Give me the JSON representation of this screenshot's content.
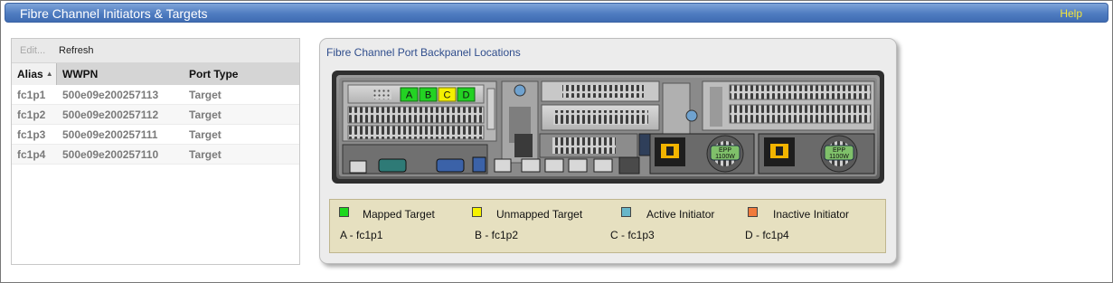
{
  "window": {
    "title": "Fibre Channel Initiators & Targets",
    "help_label": "Help"
  },
  "toolbar": {
    "edit_label": "Edit...",
    "refresh_label": "Refresh"
  },
  "table": {
    "columns": [
      "Alias",
      "WWPN",
      "Port Type"
    ],
    "sort_indicator": "▲",
    "rows": [
      {
        "alias": "fc1p1",
        "wwpn": "500e09e200257113",
        "port_type": "Target"
      },
      {
        "alias": "fc1p2",
        "wwpn": "500e09e200257112",
        "port_type": "Target"
      },
      {
        "alias": "fc1p3",
        "wwpn": "500e09e200257111",
        "port_type": "Target"
      },
      {
        "alias": "fc1p4",
        "wwpn": "500e09e200257110",
        "port_type": "Target"
      }
    ]
  },
  "backpanel": {
    "title": "Fibre Channel Port Backpanel Locations",
    "ports": [
      {
        "letter": "A",
        "color": "#23d223"
      },
      {
        "letter": "B",
        "color": "#23d223"
      },
      {
        "letter": "C",
        "color": "#f4f000"
      },
      {
        "letter": "D",
        "color": "#23d223"
      }
    ],
    "psu_label": "1100W",
    "psu_brand": "EPP"
  },
  "legend": {
    "items": [
      {
        "label": "Mapped Target",
        "color": "#1ed81e"
      },
      {
        "label": "Unmapped Target",
        "color": "#f6f200"
      },
      {
        "label": "Active Initiator",
        "color": "#68b6c9"
      },
      {
        "label": "Inactive Initiator",
        "color": "#f07a3c"
      }
    ],
    "port_map": [
      "A - fc1p1",
      "B - fc1p2",
      "C - fc1p3",
      "D - fc1p4"
    ]
  }
}
